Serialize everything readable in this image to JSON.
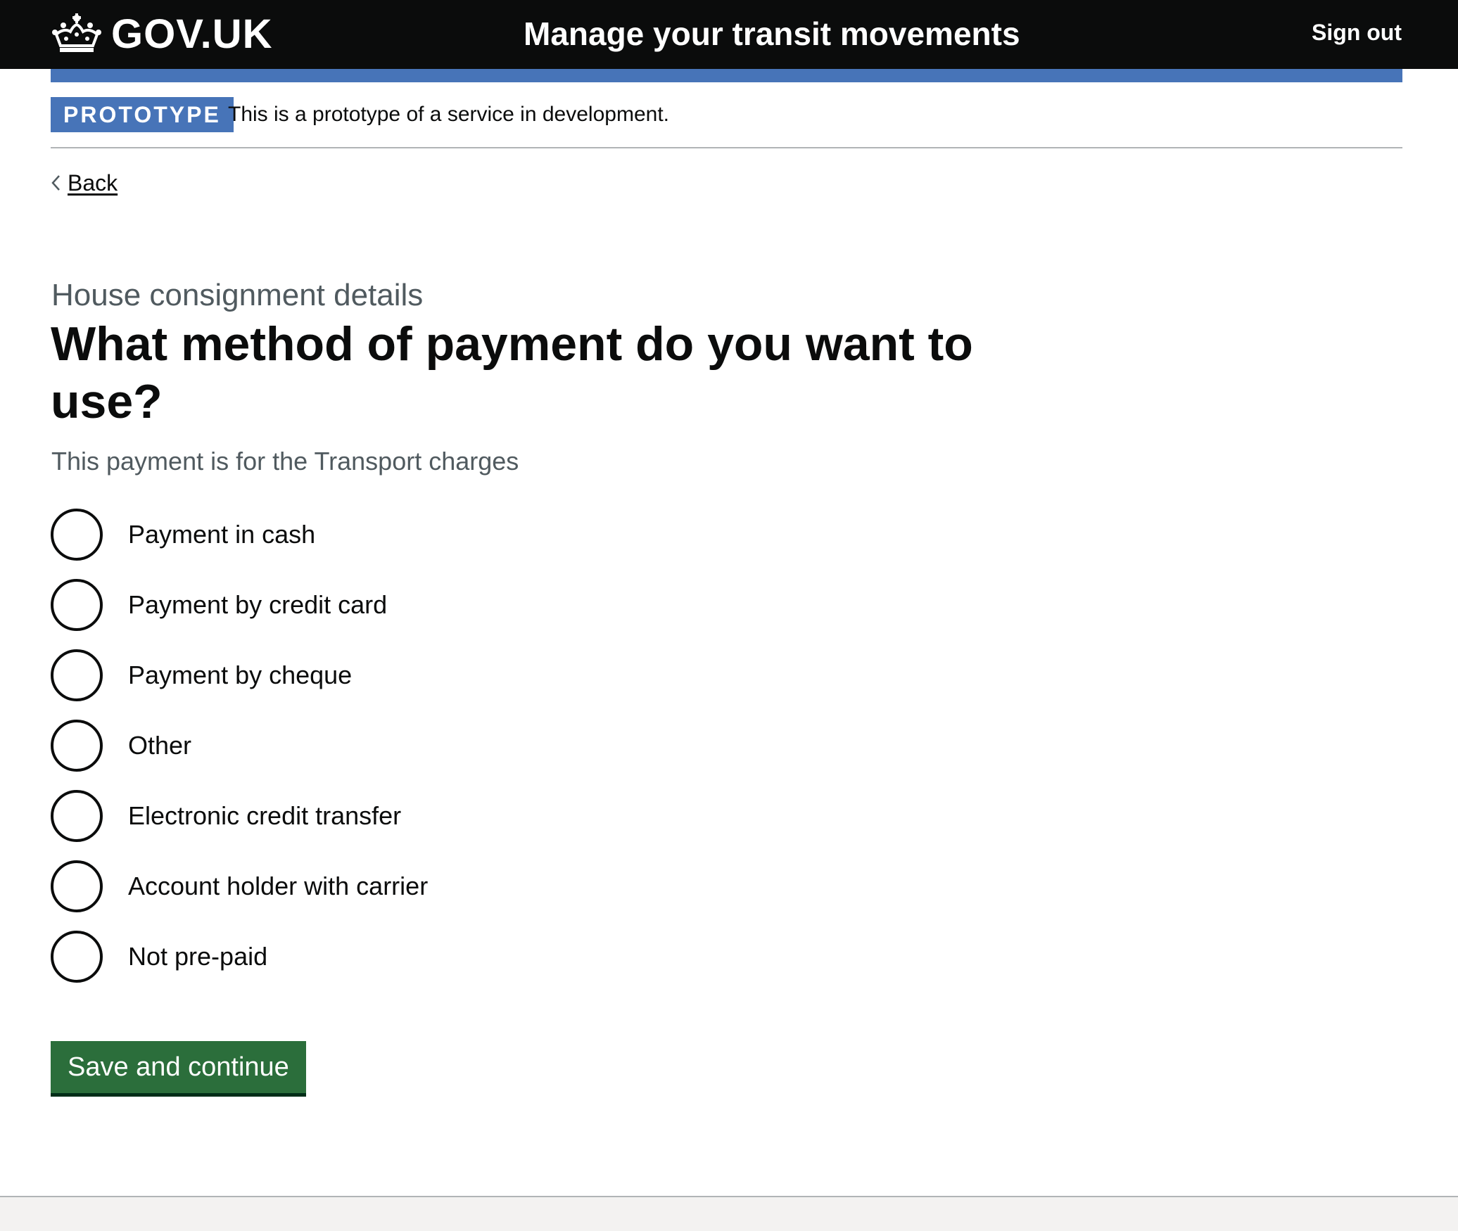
{
  "header": {
    "logo_text": "GOV.UK",
    "logo_icon": "crown-icon",
    "service_name": "Manage your transit movements",
    "sign_out_label": "Sign out"
  },
  "phase_banner": {
    "tag": "PROTOTYPE",
    "text": "This is a prototype of a service in development."
  },
  "back_link": {
    "label": "Back",
    "icon": "chevron-left-icon"
  },
  "main": {
    "caption": "House consignment details",
    "heading": "What method of payment do you want to use?",
    "hint": "This payment is for the Transport charges",
    "options": [
      {
        "label": "Payment in cash"
      },
      {
        "label": "Payment by credit card"
      },
      {
        "label": "Payment by cheque"
      },
      {
        "label": "Other"
      },
      {
        "label": "Electronic credit transfer"
      },
      {
        "label": "Account holder with carrier"
      },
      {
        "label": "Not pre-paid"
      }
    ],
    "submit_label": "Save and continue"
  },
  "colors": {
    "header_bg": "#0b0c0c",
    "accent_blue": "#4774b8",
    "button_green": "#2b6e3b",
    "secondary_text": "#505a5f"
  }
}
